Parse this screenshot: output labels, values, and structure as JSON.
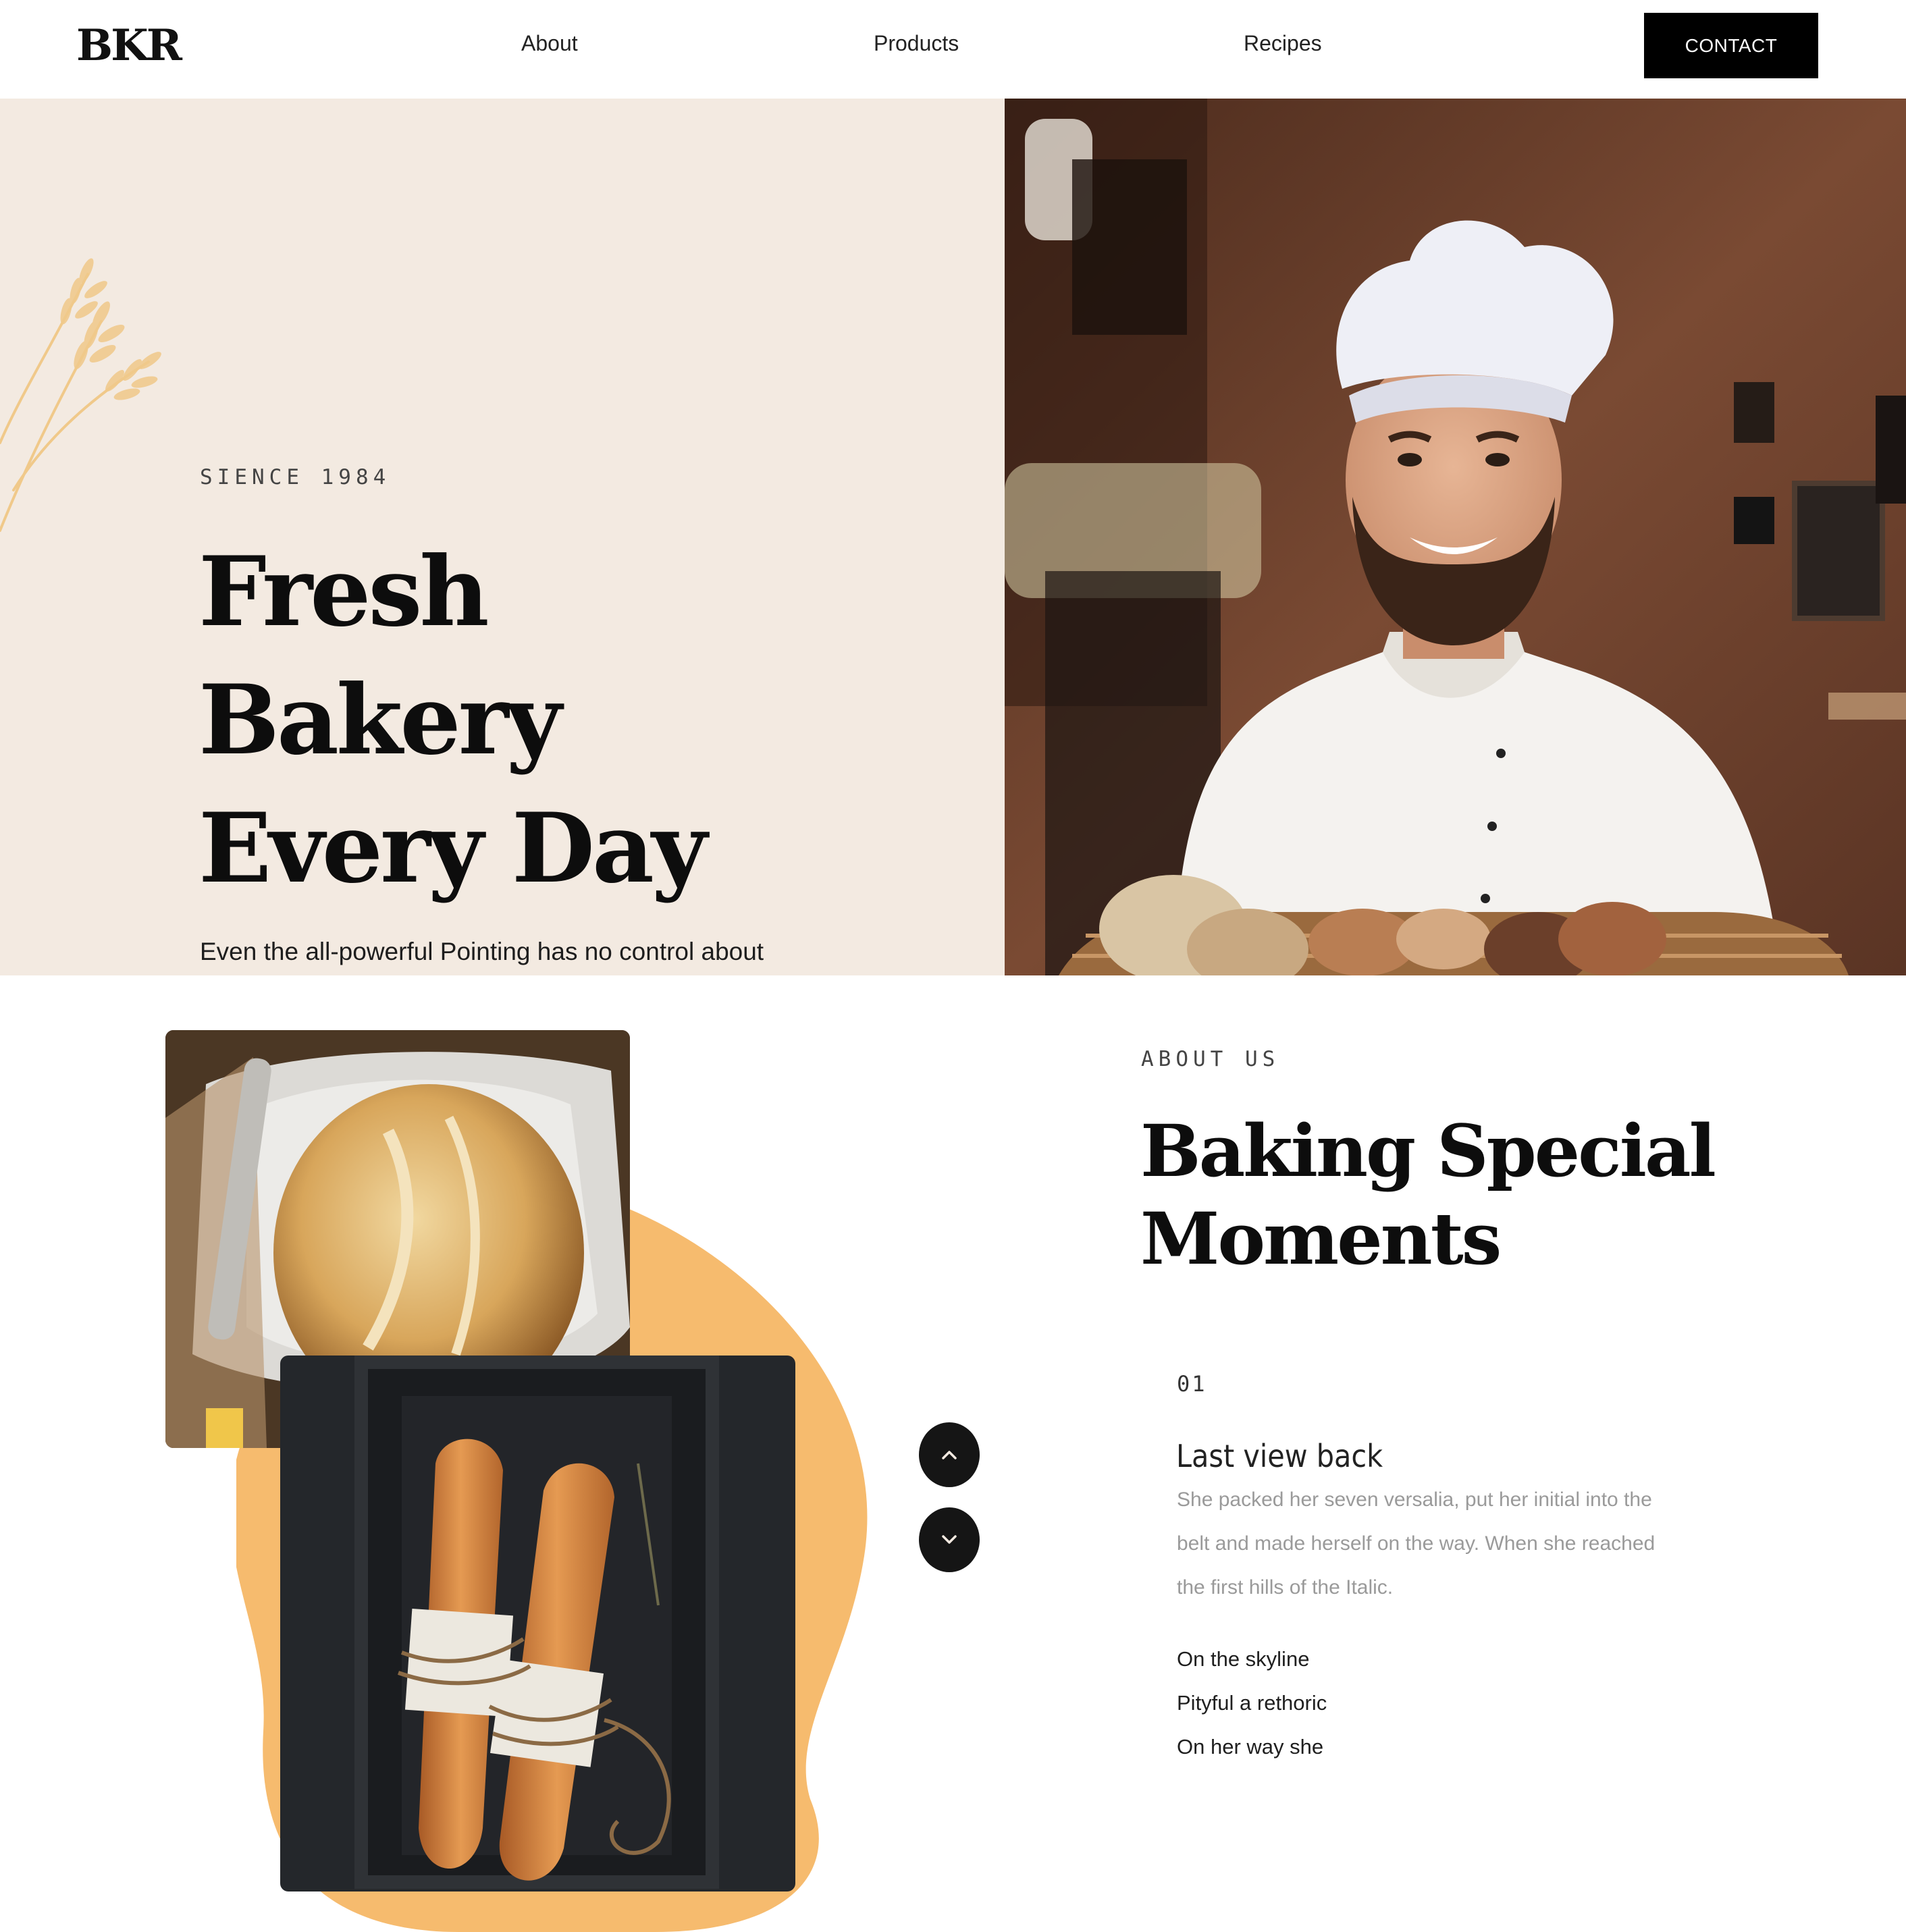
{
  "header": {
    "logo": "BKR",
    "nav": [
      "About",
      "Products",
      "Recipes"
    ],
    "contact_label": "CONTACT"
  },
  "hero": {
    "eyebrow": "SIENCE 1984",
    "title_lines": [
      "Fresh",
      "Bakery",
      "Every Day"
    ],
    "description": "Even the all-powerful Pointing has no control about the blind texts it is an almost."
  },
  "about": {
    "eyebrow": "ABOUT US",
    "title_lines": [
      "Baking Special",
      "Moments"
    ],
    "item": {
      "number": "01",
      "title": "Last view back",
      "description": "She packed her seven versalia, put her initial into the belt and made herself on the way. When she reached the first hills of the Italic.",
      "list": [
        "On the skyline",
        "Pityful a rethoric",
        "On her way she"
      ]
    },
    "nav_icons": [
      "chevron-up-icon",
      "chevron-down-icon"
    ]
  },
  "colors": {
    "hero_bg": "#f3eae1",
    "accent_blob": "#f6bb6e",
    "button_dark": "#000000",
    "wheat": "#f0c98a"
  }
}
